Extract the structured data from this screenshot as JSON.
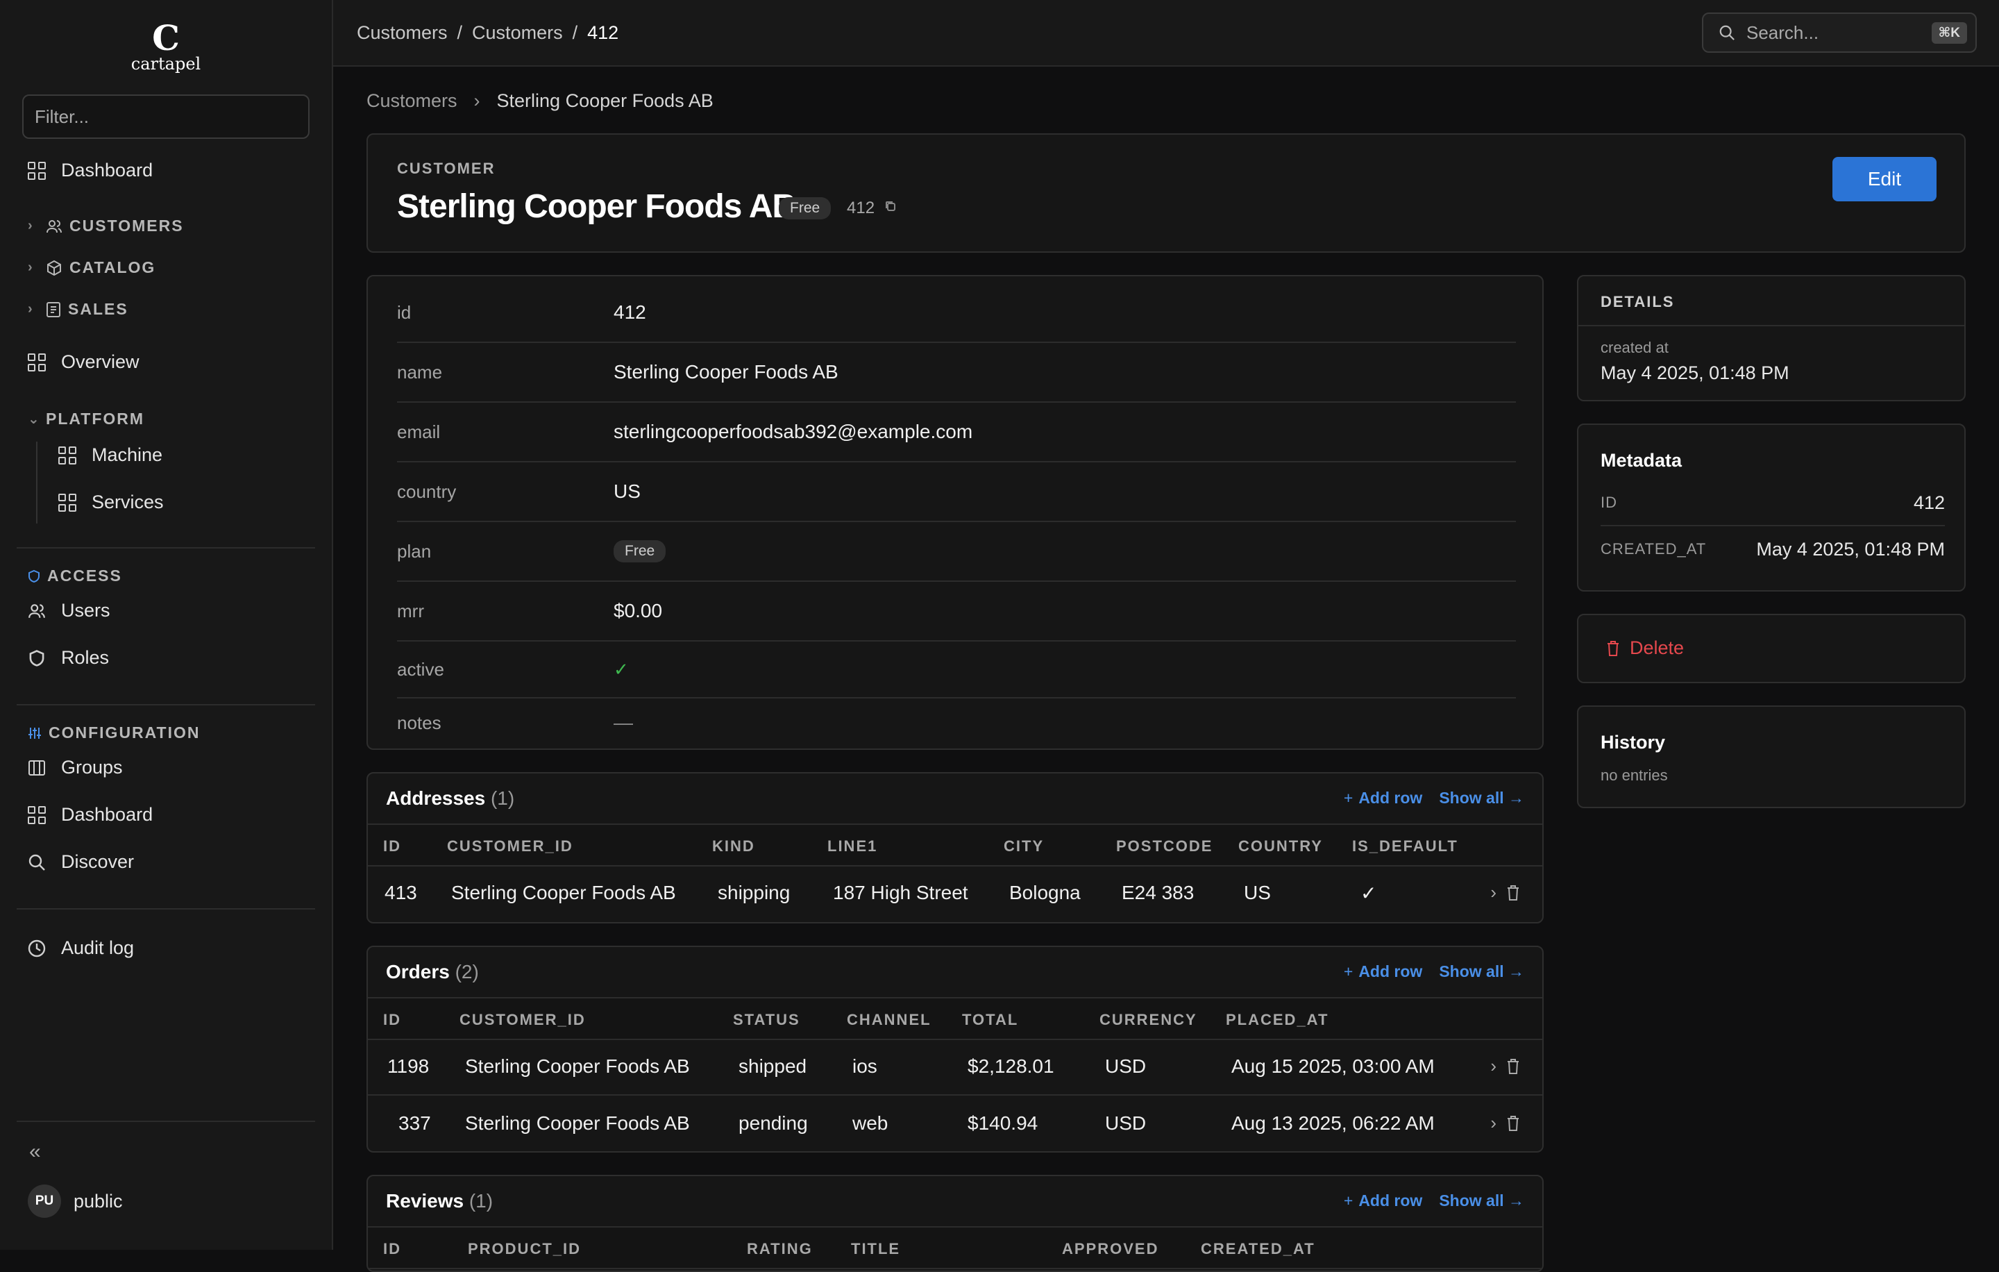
{
  "app": {
    "logo_mark": "C",
    "logo_name": "cartapel",
    "filter_placeholder": "Filter..."
  },
  "sidebar": {
    "dashboard": "Dashboard",
    "sections": {
      "customers": "CUSTOMERS",
      "catalog": "CATALOG",
      "sales": "SALES",
      "platform": "PLATFORM",
      "access": "ACCESS",
      "configuration": "CONFIGURATION"
    },
    "overview": "Overview",
    "machine": "Machine",
    "services": "Services",
    "users": "Users",
    "roles": "Roles",
    "groups": "Groups",
    "dashboard2": "Dashboard",
    "discover": "Discover",
    "audit_log": "Audit log",
    "collapse": "«",
    "user_initials": "PU",
    "user_name": "public"
  },
  "topbar": {
    "crumbs": [
      "Customers",
      "/",
      "Customers",
      "/",
      "412"
    ],
    "search_placeholder": "Search...",
    "search_kbd": "⌘K"
  },
  "breadcrumb": {
    "parent": "Customers",
    "sep": "›",
    "current": "Sterling Cooper Foods AB"
  },
  "record": {
    "label": "CUSTOMER",
    "title": "Sterling Cooper Foods AB",
    "plan_badge": "Free",
    "id": "412",
    "edit_label": "Edit"
  },
  "fields": [
    {
      "key": "id",
      "value": "412"
    },
    {
      "key": "name",
      "value": "Sterling Cooper Foods AB"
    },
    {
      "key": "email",
      "value": "sterlingcooperfoodsab392@example.com"
    },
    {
      "key": "country",
      "value": "US"
    },
    {
      "key": "plan",
      "value": "Free"
    },
    {
      "key": "mrr",
      "value": "$0.00"
    },
    {
      "key": "active",
      "value": "✓"
    },
    {
      "key": "notes",
      "value": "—"
    }
  ],
  "relations": {
    "add_row": "Add row",
    "show_all": "Show all →",
    "addresses": {
      "title": "Addresses",
      "count": "(1)",
      "columns": [
        "ID",
        "CUSTOMER_ID",
        "KIND",
        "LINE1",
        "CITY",
        "POSTCODE",
        "COUNTRY",
        "IS_DEFAULT"
      ],
      "rows": [
        [
          "413",
          "Sterling Cooper Foods AB",
          "shipping",
          "187 High Street",
          "Bologna",
          "E24 383",
          "US",
          "✓"
        ]
      ]
    },
    "orders": {
      "title": "Orders",
      "count": "(2)",
      "columns": [
        "ID",
        "CUSTOMER_ID",
        "STATUS",
        "CHANNEL",
        "TOTAL",
        "CURRENCY",
        "PLACED_AT"
      ],
      "rows": [
        [
          "1198",
          "Sterling Cooper Foods AB",
          "shipped",
          "ios",
          "$2,128.01",
          "USD",
          "Aug 15 2025, 03:00 AM"
        ],
        [
          "337",
          "Sterling Cooper Foods AB",
          "pending",
          "web",
          "$140.94",
          "USD",
          "Aug 13 2025, 06:22 AM"
        ]
      ]
    },
    "reviews": {
      "title": "Reviews",
      "count": "(1)",
      "columns": [
        "ID",
        "PRODUCT_ID",
        "RATING",
        "TITLE",
        "APPROVED",
        "CREATED_AT"
      ]
    }
  },
  "details": {
    "label": "DETAILS",
    "created_label": "created at",
    "created_value": "May 4 2025, 01:48 PM"
  },
  "metadata": {
    "title": "Metadata",
    "rows": [
      {
        "key": "ID",
        "value": "412"
      },
      {
        "key": "CREATED_AT",
        "value": "May 4 2025, 01:48 PM"
      }
    ]
  },
  "delete_label": "Delete",
  "history": {
    "title": "History",
    "empty": "no entries"
  },
  "colors": {
    "accent": "#2b74d6",
    "link": "#4a8fe7",
    "danger": "#e5484d",
    "success": "#3fb950"
  }
}
